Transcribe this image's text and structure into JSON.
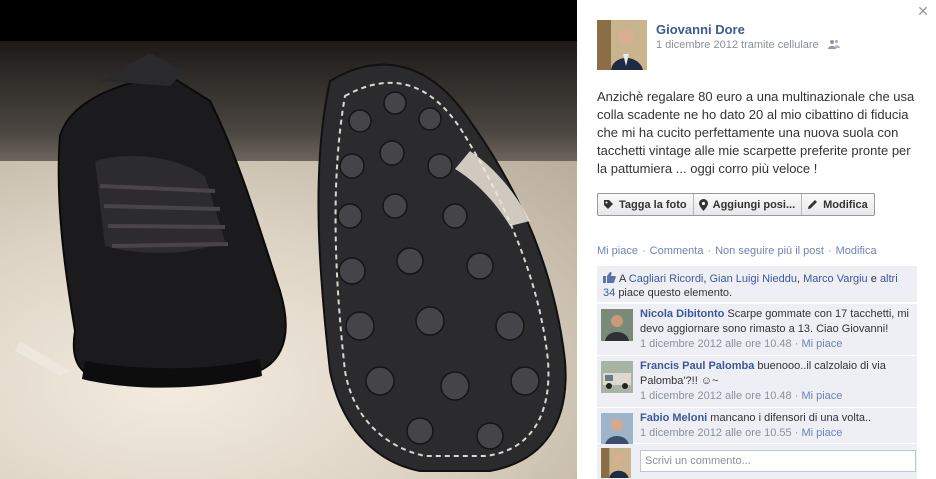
{
  "photo": {
    "alt": "Scarpe da calcio con tacchetti"
  },
  "post": {
    "author": "Giovanni Dore",
    "date": "1 dicembre 2012",
    "via": "tramite cellulare",
    "text": "Anzichè regalare 80 euro a una multinazionale che usa colla scadente ne ho dato 20 al mio cibattino di fiducia che mi ha cucito perfettamente una nuova suola con tacchetti vintage alle mie scarpette preferite pronte per la pattumiera ... oggi corro più veloce !"
  },
  "photo_actions": {
    "tag": "Tagga la foto",
    "location": "Aggiungi posi...",
    "edit": "Modifica"
  },
  "actions": {
    "like": "Mi piace",
    "comment": "Commenta",
    "unfollow": "Non seguire più il post",
    "edit": "Modifica",
    "separator": "·"
  },
  "likes": {
    "prefix": "A",
    "people": [
      "Cagliari Ricordi",
      "Gian Luigi Nieddu",
      "Marco Vargiu"
    ],
    "others": "altri 34",
    "and": "e",
    "suffix": "piace questo elemento."
  },
  "comments": [
    {
      "name": "Nicola Dibitonto",
      "text": "Scarpe gommate con 17 tacchetti, mi devo aggiornare sono rimasto a 13. Ciao Giovanni!",
      "time": "1 dicembre 2012 alle ore 10.48",
      "like": "Mi piace"
    },
    {
      "name": "Francis Paul Palomba",
      "text": "buenooo..il calzolaio di via Palomba'?!! ☺~",
      "time": "1 dicembre 2012 alle ore 10.48",
      "like": "Mi piace"
    },
    {
      "name": "Fabio Meloni",
      "text": "mancano i difensori di una volta..",
      "time": "1 dicembre 2012 alle ore 10.55",
      "like": "Mi piace"
    }
  ],
  "composer": {
    "placeholder": "Scrivi un commento..."
  },
  "icons": {
    "close": "close-icon",
    "tag": "tag-icon",
    "location": "location-pin-icon",
    "edit": "pencil-icon",
    "thumb": "thumbs-up-icon",
    "audience": "friends-icon"
  },
  "colors": {
    "link": "#3b5998",
    "meta": "#89919c",
    "panel_bg": "#edeff4"
  }
}
